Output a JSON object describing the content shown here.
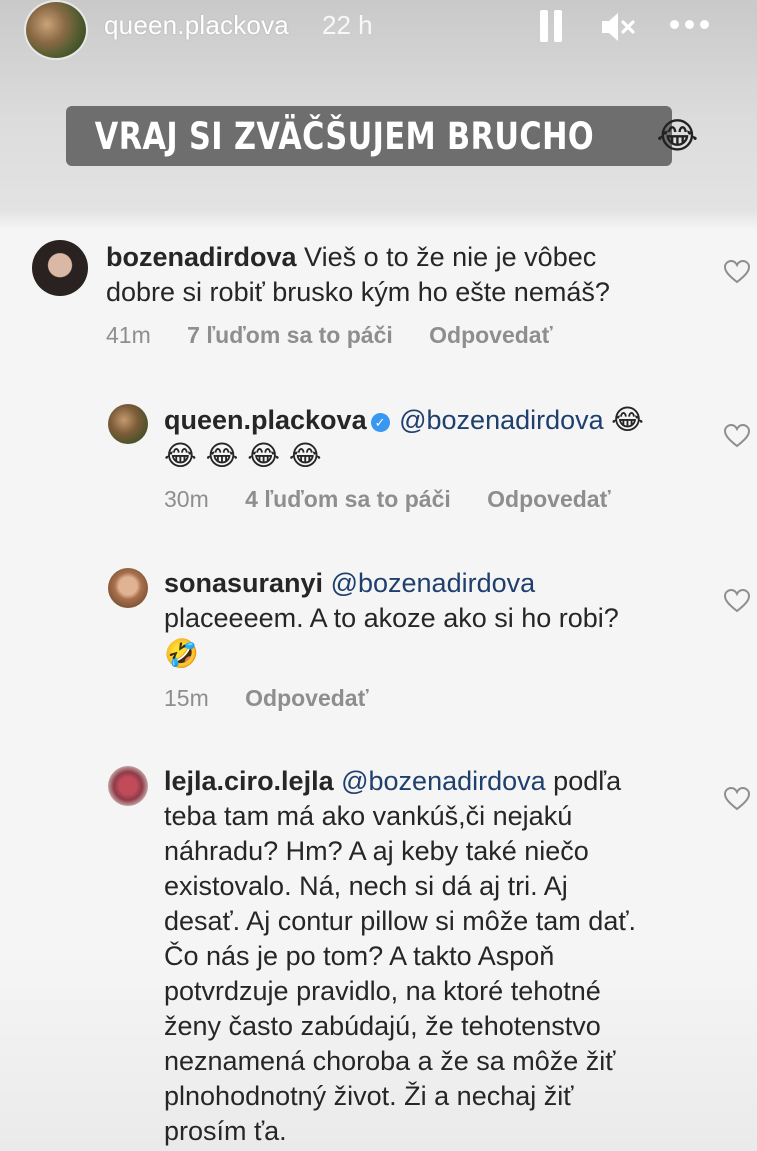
{
  "header": {
    "username": "queen.plackova",
    "time": "22 h",
    "pause_icon": "pause-icon",
    "mute_icon": "speaker-muted-icon",
    "more_icon": "more-icon"
  },
  "caption": {
    "text": "VRAJ SI ZVÄČŠUJEM BRUCHO",
    "emoji": "😂"
  },
  "comments": [
    {
      "username": "bozenadirdova",
      "text_line1": "Vieš o to že nie je vôbec",
      "text_line2": "dobre si robiť brusko kým ho ešte nemáš?",
      "time": "41m",
      "likes": "7 ľuďom sa to páči",
      "reply": "Odpovedať"
    },
    {
      "username": "queen.plackova",
      "mention": "@bozenadirdova",
      "emoji_line1": "😂",
      "emoji_line2": "😂 😂 😂 😂",
      "time": "30m",
      "likes": "4 ľuďom sa to páči",
      "reply": "Odpovedať"
    },
    {
      "username": "sonasuranyi",
      "mention": "@bozenadirdova",
      "text_line1": "placeeeem. A to akoze ako si ho robi?",
      "emoji": "🤣",
      "time": "15m",
      "reply": "Odpovedať"
    },
    {
      "username": "lejla.ciro.lejla",
      "mention": "@bozenadirdova",
      "text_first": "podľa",
      "lines": [
        "teba tam má ako vankúš,či nejakú",
        "náhradu? Hm? A aj keby také niečo",
        "existovalo. Ná, nech si dá aj tri. Aj",
        "desať. Aj contur pillow si môže tam dať.",
        "Čo nás je po tom? A takto Aspoň",
        "potvrdzuje pravidlo, na ktoré tehotné",
        "ženy často zabúdajú, že tehotenstvo",
        "neznamená choroba a že sa môže žiť",
        "plnohodnotný život. Ži a nechaj žiť",
        "prosím ťa."
      ]
    }
  ]
}
